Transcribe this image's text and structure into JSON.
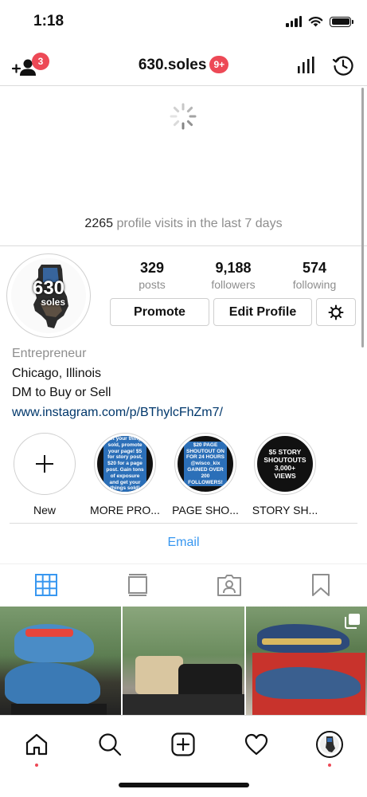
{
  "status": {
    "time": "1:18"
  },
  "header": {
    "username": "630.soles",
    "username_badge": "9+",
    "add_user_badge": "3"
  },
  "visits": {
    "count": "2265",
    "text": "profile visits in the last 7 days"
  },
  "profile": {
    "avatar_text_line1": "630",
    "avatar_text_line2": "soles",
    "posts": {
      "value": "329",
      "label": "posts"
    },
    "followers": {
      "value": "9,188",
      "label": "followers"
    },
    "following": {
      "value": "574",
      "label": "following"
    },
    "promote_label": "Promote",
    "edit_label": "Edit Profile"
  },
  "bio": {
    "category": "Entrepreneur",
    "line1": "Chicago, Illinois",
    "line2": "DM to Buy or Sell",
    "link": "www.instagram.com/p/BThylcFhZm7/"
  },
  "highlights": [
    {
      "label": "New",
      "cover": ""
    },
    {
      "label": "MORE PRO...",
      "cover": "Get your things sold, promote your page! $5 for story post, $20 for a page post. Gain tons of exposure and get your things sold!"
    },
    {
      "label": "PAGE SHO...",
      "cover": "$20 PAGE SHOUTOUT ON FOR 24 HOURS @wisco_kix GAINED OVER 200 FOLLOWERS!"
    },
    {
      "label": "STORY SH...",
      "cover": "$5 STORY SHOUTOUTS 3,000+ VIEWS"
    }
  ],
  "contact": {
    "email_label": "Email"
  },
  "colors": {
    "accent": "#3897f0",
    "badge": "#ed4956",
    "link": "#00376b",
    "muted": "#8e8e8e"
  },
  "icons": {
    "header": [
      "add-user-icon",
      "insights-icon",
      "archive-history-icon"
    ],
    "tabs": [
      "grid-icon",
      "feed-icon",
      "tagged-icon",
      "saved-icon"
    ],
    "nav": [
      "home-icon",
      "search-icon",
      "new-post-icon",
      "activity-icon",
      "profile-avatar-icon"
    ]
  }
}
